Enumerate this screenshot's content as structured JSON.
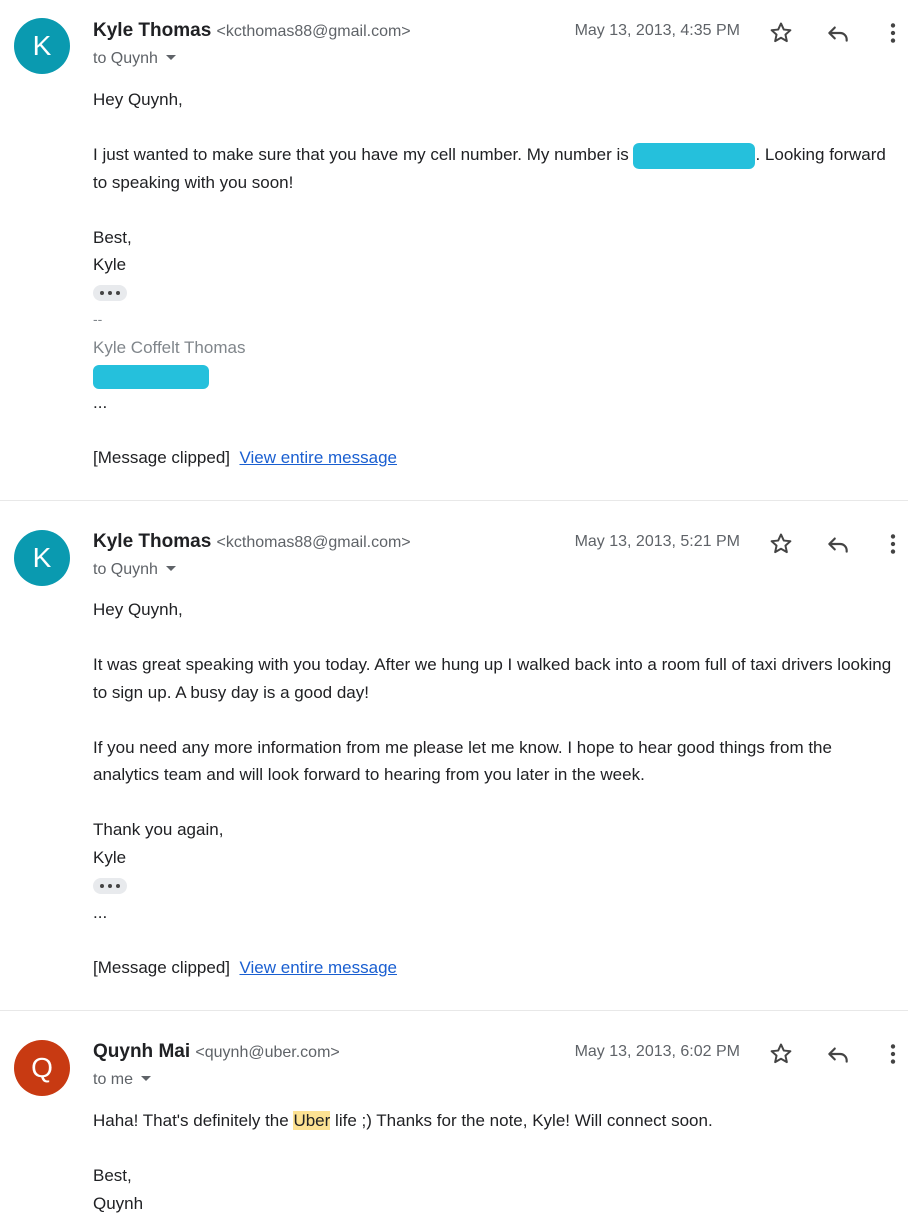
{
  "messages": [
    {
      "avatar_letter": "K",
      "avatar_color": "#0a9ab0",
      "sender_name": "Kyle Thomas",
      "sender_email": "<kcthomas88@gmail.com>",
      "recipients": "to Quynh",
      "date": "May 13, 2013, 4:35 PM",
      "greeting": "Hey Quynh,",
      "para1_before": "I just wanted to make sure that you have my cell number. My number is ",
      "para1_after": ". Looking forward to speaking with you soon!",
      "closing": "Best,",
      "signoff": "Kyle",
      "sig_dash": "--",
      "sig_name": "Kyle Coffelt Thomas",
      "ellipsis": "...",
      "clipped": "[Message clipped]",
      "view_link": "View entire message"
    },
    {
      "avatar_letter": "K",
      "avatar_color": "#0a9ab0",
      "sender_name": "Kyle Thomas",
      "sender_email": "<kcthomas88@gmail.com>",
      "recipients": "to Quynh",
      "date": "May 13, 2013, 5:21 PM",
      "greeting": "Hey Quynh,",
      "para1": "It was great speaking with you today. After we hung up I walked back into a room full of taxi drivers looking to sign up. A busy day is a good day!",
      "para2": "If you need any more information from me please let me know. I hope to hear good things from the analytics team and will look forward to hearing from you later in the week.",
      "closing": "Thank you again,",
      "signoff": "Kyle",
      "ellipsis": "...",
      "clipped": "[Message clipped]",
      "view_link": "View entire message"
    },
    {
      "avatar_letter": "Q",
      "avatar_color": "#c83a12",
      "sender_name": "Quynh Mai",
      "sender_email": "<quynh@uber.com>",
      "recipients": "to me",
      "date": "May 13, 2013, 6:02 PM",
      "body_before": "Haha! That's definitely the ",
      "body_highlight": "Uber",
      "body_after": " life ;) Thanks for the note, Kyle! Will connect soon.",
      "closing": "Best,",
      "signoff": "Quynh"
    }
  ],
  "icons": {
    "star": "star-icon",
    "reply": "reply-icon",
    "more": "more-vert-icon",
    "caret": "chevron-down-icon"
  },
  "colors": {
    "link": "#1a5fd1",
    "highlight": "#fde293",
    "redaction": "#25c0dc"
  }
}
